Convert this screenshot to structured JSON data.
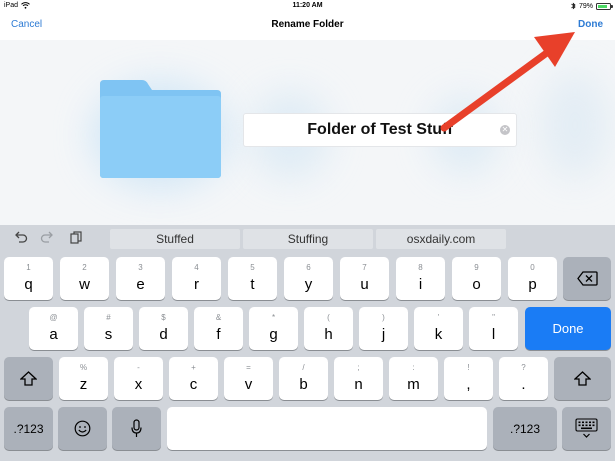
{
  "status_bar": {
    "device": "iPad",
    "time": "11:20 AM",
    "battery": "79%",
    "battery_level": 0.79
  },
  "nav": {
    "cancel_label": "Cancel",
    "title": "Rename Folder",
    "done_label": "Done"
  },
  "folder": {
    "name_value": "Folder of Test Stuff"
  },
  "colors": {
    "accent": "#2d7bd4",
    "arrow": "#e8402a",
    "folder": "#8ccdf7",
    "done_key": "#1a7cf5"
  },
  "keyboard": {
    "suggestions": [
      "Stuffed",
      "Stuffing",
      "osxdaily.com"
    ],
    "row1": [
      {
        "hint": "1",
        "key": "q"
      },
      {
        "hint": "2",
        "key": "w"
      },
      {
        "hint": "3",
        "key": "e"
      },
      {
        "hint": "4",
        "key": "r"
      },
      {
        "hint": "5",
        "key": "t"
      },
      {
        "hint": "6",
        "key": "y"
      },
      {
        "hint": "7",
        "key": "u"
      },
      {
        "hint": "8",
        "key": "i"
      },
      {
        "hint": "9",
        "key": "o"
      },
      {
        "hint": "0",
        "key": "p"
      }
    ],
    "row2": [
      {
        "hint": "@",
        "key": "a"
      },
      {
        "hint": "#",
        "key": "s"
      },
      {
        "hint": "$",
        "key": "d"
      },
      {
        "hint": "&",
        "key": "f"
      },
      {
        "hint": "*",
        "key": "g"
      },
      {
        "hint": "(",
        "key": "h"
      },
      {
        "hint": ")",
        "key": "j"
      },
      {
        "hint": "'",
        "key": "k"
      },
      {
        "hint": "\"",
        "key": "l"
      }
    ],
    "row3": [
      {
        "hint": "%",
        "key": "z"
      },
      {
        "hint": "-",
        "key": "x"
      },
      {
        "hint": "+",
        "key": "c"
      },
      {
        "hint": "=",
        "key": "v"
      },
      {
        "hint": "/",
        "key": "b"
      },
      {
        "hint": ";",
        "key": "n"
      },
      {
        "hint": ":",
        "key": "m"
      },
      {
        "hint": "!",
        "key": ","
      },
      {
        "hint": "?",
        "key": "."
      }
    ],
    "done_key": "Done",
    "numbers_key": ".?123",
    "icons": {
      "undo": "undo-icon",
      "redo": "redo-icon",
      "paste": "paste-icon",
      "delete": "backspace-icon",
      "shift": "shift-icon",
      "emoji": "emoji-icon",
      "mic": "microphone-icon",
      "hide": "hide-keyboard-icon"
    }
  }
}
